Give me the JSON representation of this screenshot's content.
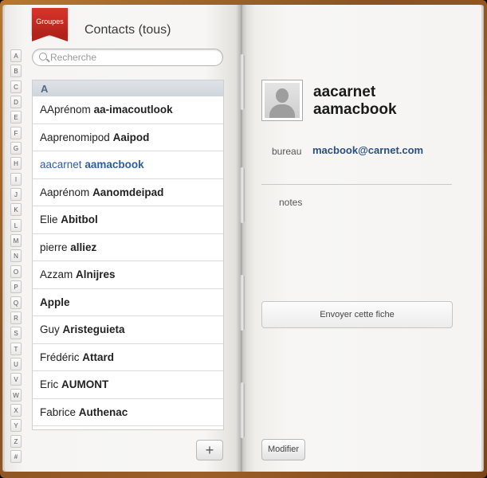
{
  "header": {
    "groups_label": "Groupes",
    "title": "Contacts (tous)"
  },
  "search": {
    "placeholder": "Recherche",
    "value": ""
  },
  "alphabet_index": [
    "A",
    "B",
    "C",
    "D",
    "E",
    "F",
    "G",
    "H",
    "I",
    "J",
    "K",
    "L",
    "M",
    "N",
    "O",
    "P",
    "Q",
    "R",
    "S",
    "T",
    "U",
    "V",
    "W",
    "X",
    "Y",
    "Z",
    "#"
  ],
  "list": {
    "section_header": "A",
    "rows": [
      {
        "first": "AAprénom",
        "last": "aa-imacoutlook"
      },
      {
        "first": "Aaprenomipod",
        "last": "Aaipod"
      },
      {
        "first": "aacarnet",
        "last": "aamacbook"
      },
      {
        "first": "Aaprénom",
        "last": "Aanomdeipad"
      },
      {
        "first": "Elie",
        "last": "Abitbol"
      },
      {
        "first": "pierre",
        "last": "alliez"
      },
      {
        "first": "Azzam",
        "last": "Alnijres"
      },
      {
        "first": "",
        "last": "Apple"
      },
      {
        "first": "Guy",
        "last": "Aristeguieta"
      },
      {
        "first": "Frédéric",
        "last": "Attard"
      },
      {
        "first": "Eric",
        "last": "AUMONT"
      },
      {
        "first": "Fabrice",
        "last": "Authenac"
      }
    ],
    "selected_index": 2,
    "add_label": "+"
  },
  "detail": {
    "name_line1": "aacarnet",
    "name_line2": "aamacbook",
    "field_label": "bureau",
    "field_value": "macbook@carnet.com",
    "notes_label": "notes",
    "send_label": "Envoyer cette fiche",
    "edit_label": "Modifier"
  },
  "colors": {
    "accent_blue": "#2c5ea8",
    "ribbon_red": "#c62a22",
    "leather": "#8a5220"
  }
}
